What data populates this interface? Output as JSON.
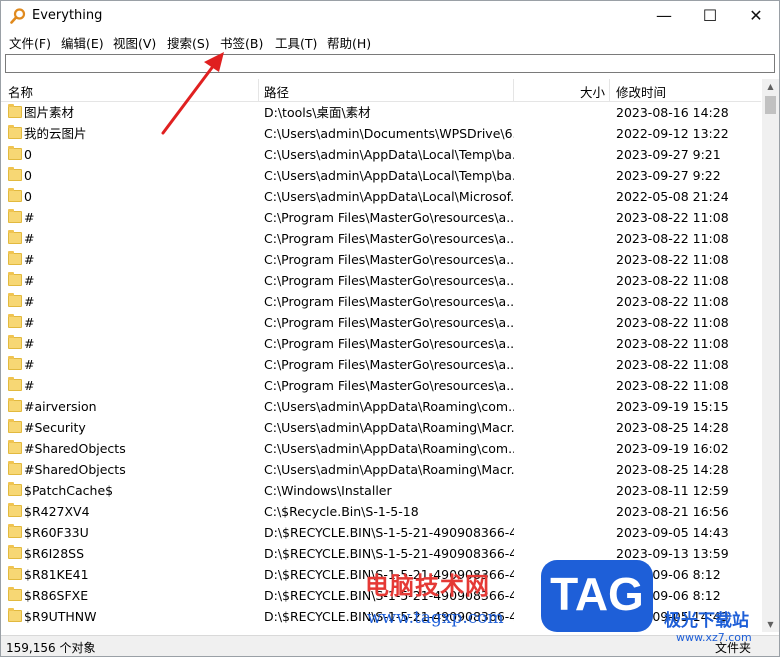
{
  "window": {
    "title": "Everything"
  },
  "titlebar_buttons": {
    "minimize": "—",
    "maximize": "☐",
    "close": "✕"
  },
  "menu": [
    "文件(F)",
    "编辑(E)",
    "视图(V)",
    "搜索(S)",
    "书签(B)",
    "工具(T)",
    "帮助(H)"
  ],
  "search": {
    "value": "",
    "placeholder": ""
  },
  "columns": {
    "name": "名称",
    "path": "路径",
    "size": "大小",
    "date": "修改时间"
  },
  "rows": [
    {
      "name": "图片素材",
      "path": "D:\\tools\\桌面\\素材",
      "size": "",
      "date": "2023-08-16 14:28"
    },
    {
      "name": "我的云图片",
      "path": "C:\\Users\\admin\\Documents\\WPSDrive\\6...",
      "size": "",
      "date": "2022-09-12 13:22"
    },
    {
      "name": "0",
      "path": "C:\\Users\\admin\\AppData\\Local\\Temp\\ba...",
      "size": "",
      "date": "2023-09-27 9:21"
    },
    {
      "name": "0",
      "path": "C:\\Users\\admin\\AppData\\Local\\Temp\\ba...",
      "size": "",
      "date": "2023-09-27 9:22"
    },
    {
      "name": "0",
      "path": "C:\\Users\\admin\\AppData\\Local\\Microsof...",
      "size": "",
      "date": "2022-05-08 21:24"
    },
    {
      "name": "#",
      "path": "C:\\Program Files\\MasterGo\\resources\\a...",
      "size": "",
      "date": "2023-08-22 11:08"
    },
    {
      "name": "#",
      "path": "C:\\Program Files\\MasterGo\\resources\\a...",
      "size": "",
      "date": "2023-08-22 11:08"
    },
    {
      "name": "#",
      "path": "C:\\Program Files\\MasterGo\\resources\\a...",
      "size": "",
      "date": "2023-08-22 11:08"
    },
    {
      "name": "#",
      "path": "C:\\Program Files\\MasterGo\\resources\\a...",
      "size": "",
      "date": "2023-08-22 11:08"
    },
    {
      "name": "#",
      "path": "C:\\Program Files\\MasterGo\\resources\\a...",
      "size": "",
      "date": "2023-08-22 11:08"
    },
    {
      "name": "#",
      "path": "C:\\Program Files\\MasterGo\\resources\\a...",
      "size": "",
      "date": "2023-08-22 11:08"
    },
    {
      "name": "#",
      "path": "C:\\Program Files\\MasterGo\\resources\\a...",
      "size": "",
      "date": "2023-08-22 11:08"
    },
    {
      "name": "#",
      "path": "C:\\Program Files\\MasterGo\\resources\\a...",
      "size": "",
      "date": "2023-08-22 11:08"
    },
    {
      "name": "#",
      "path": "C:\\Program Files\\MasterGo\\resources\\a...",
      "size": "",
      "date": "2023-08-22 11:08"
    },
    {
      "name": "#airversion",
      "path": "C:\\Users\\admin\\AppData\\Roaming\\com....",
      "size": "",
      "date": "2023-09-19 15:15"
    },
    {
      "name": "#Security",
      "path": "C:\\Users\\admin\\AppData\\Roaming\\Macr...",
      "size": "",
      "date": "2023-08-25 14:28"
    },
    {
      "name": "#SharedObjects",
      "path": "C:\\Users\\admin\\AppData\\Roaming\\com....",
      "size": "",
      "date": "2023-09-19 16:02"
    },
    {
      "name": "#SharedObjects",
      "path": "C:\\Users\\admin\\AppData\\Roaming\\Macr...",
      "size": "",
      "date": "2023-08-25 14:28"
    },
    {
      "name": "$PatchCache$",
      "path": "C:\\Windows\\Installer",
      "size": "",
      "date": "2023-08-11 12:59"
    },
    {
      "name": "$R427XV4",
      "path": "C:\\$Recycle.Bin\\S-1-5-18",
      "size": "",
      "date": "2023-08-21 16:56"
    },
    {
      "name": "$R60F33U",
      "path": "D:\\$RECYCLE.BIN\\S-1-5-21-490908366-4...",
      "size": "",
      "date": "2023-09-05 14:43"
    },
    {
      "name": "$R6I28SS",
      "path": "D:\\$RECYCLE.BIN\\S-1-5-21-490908366-4...",
      "size": "",
      "date": "2023-09-13 13:59"
    },
    {
      "name": "$R81KE41",
      "path": "D:\\$RECYCLE.BIN\\S-1-5-21-490908366-4...",
      "size": "",
      "date": "2023-09-06 8:12"
    },
    {
      "name": "$R86SFXE",
      "path": "D:\\$RECYCLE.BIN\\S-1-5-21-490908366-4...",
      "size": "",
      "date": "2023-09-06 8:12"
    },
    {
      "name": "$R9UTHNW",
      "path": "D:\\$RECYCLE.BIN\\S-1-5-21-490908366-4...",
      "size": "",
      "date": "2023-09-05 14:43"
    }
  ],
  "status": {
    "count": "159,156 个对象",
    "right": "文件夹"
  },
  "watermark": {
    "site_cn": "电脑技术网",
    "url": "www.tagxp.com",
    "logo": "TAG",
    "right_cn": "极光下载站",
    "right_url": "www.xz7.com"
  },
  "colors": {
    "folder": "#f7d774",
    "annotation_arrow": "#e02020",
    "watermark_red": "#e53935",
    "watermark_blue": "#1e5fd8"
  }
}
